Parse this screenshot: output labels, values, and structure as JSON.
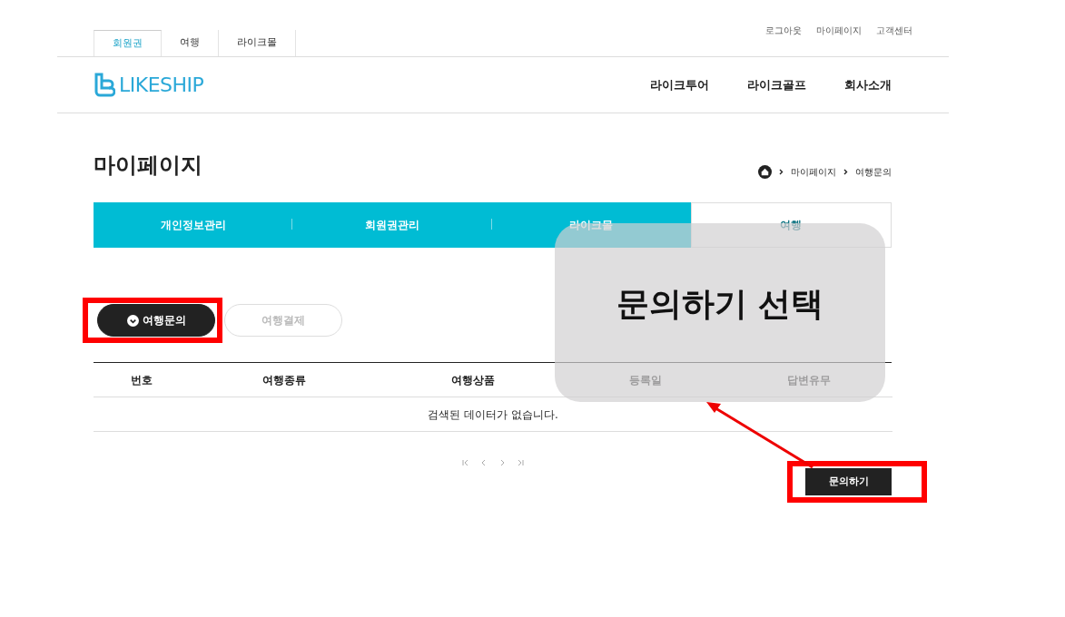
{
  "top_tabs": [
    {
      "label": "회원권",
      "selected": true
    },
    {
      "label": "여행",
      "selected": false
    },
    {
      "label": "라이크몰",
      "selected": false
    }
  ],
  "util_links": [
    "로그아웃",
    "마이페이지",
    "고객센터"
  ],
  "logo": "LIKESHIP",
  "main_nav": [
    "라이크투어",
    "라이크골프",
    "회사소개"
  ],
  "page_title": "마이페이지",
  "breadcrumb": [
    "마이페이지",
    "여행문의"
  ],
  "menu_tabs": [
    {
      "label": "개인정보관리",
      "selected": false
    },
    {
      "label": "회원권관리",
      "selected": false
    },
    {
      "label": "라이크몰",
      "selected": false
    },
    {
      "label": "여행",
      "selected": true
    }
  ],
  "sub_tabs": [
    {
      "label": "여행문의",
      "selected": true,
      "highlighted": true
    },
    {
      "label": "여행결제",
      "selected": false,
      "highlighted": false
    }
  ],
  "table": {
    "columns": [
      "번호",
      "여행종류",
      "여행상품",
      "등록일",
      "답변유무"
    ],
    "empty_message": "검색된 데이터가 없습니다."
  },
  "inquiry_button": {
    "label": "문의하기",
    "highlighted": true
  },
  "callout": {
    "text": "문의하기 선택"
  }
}
